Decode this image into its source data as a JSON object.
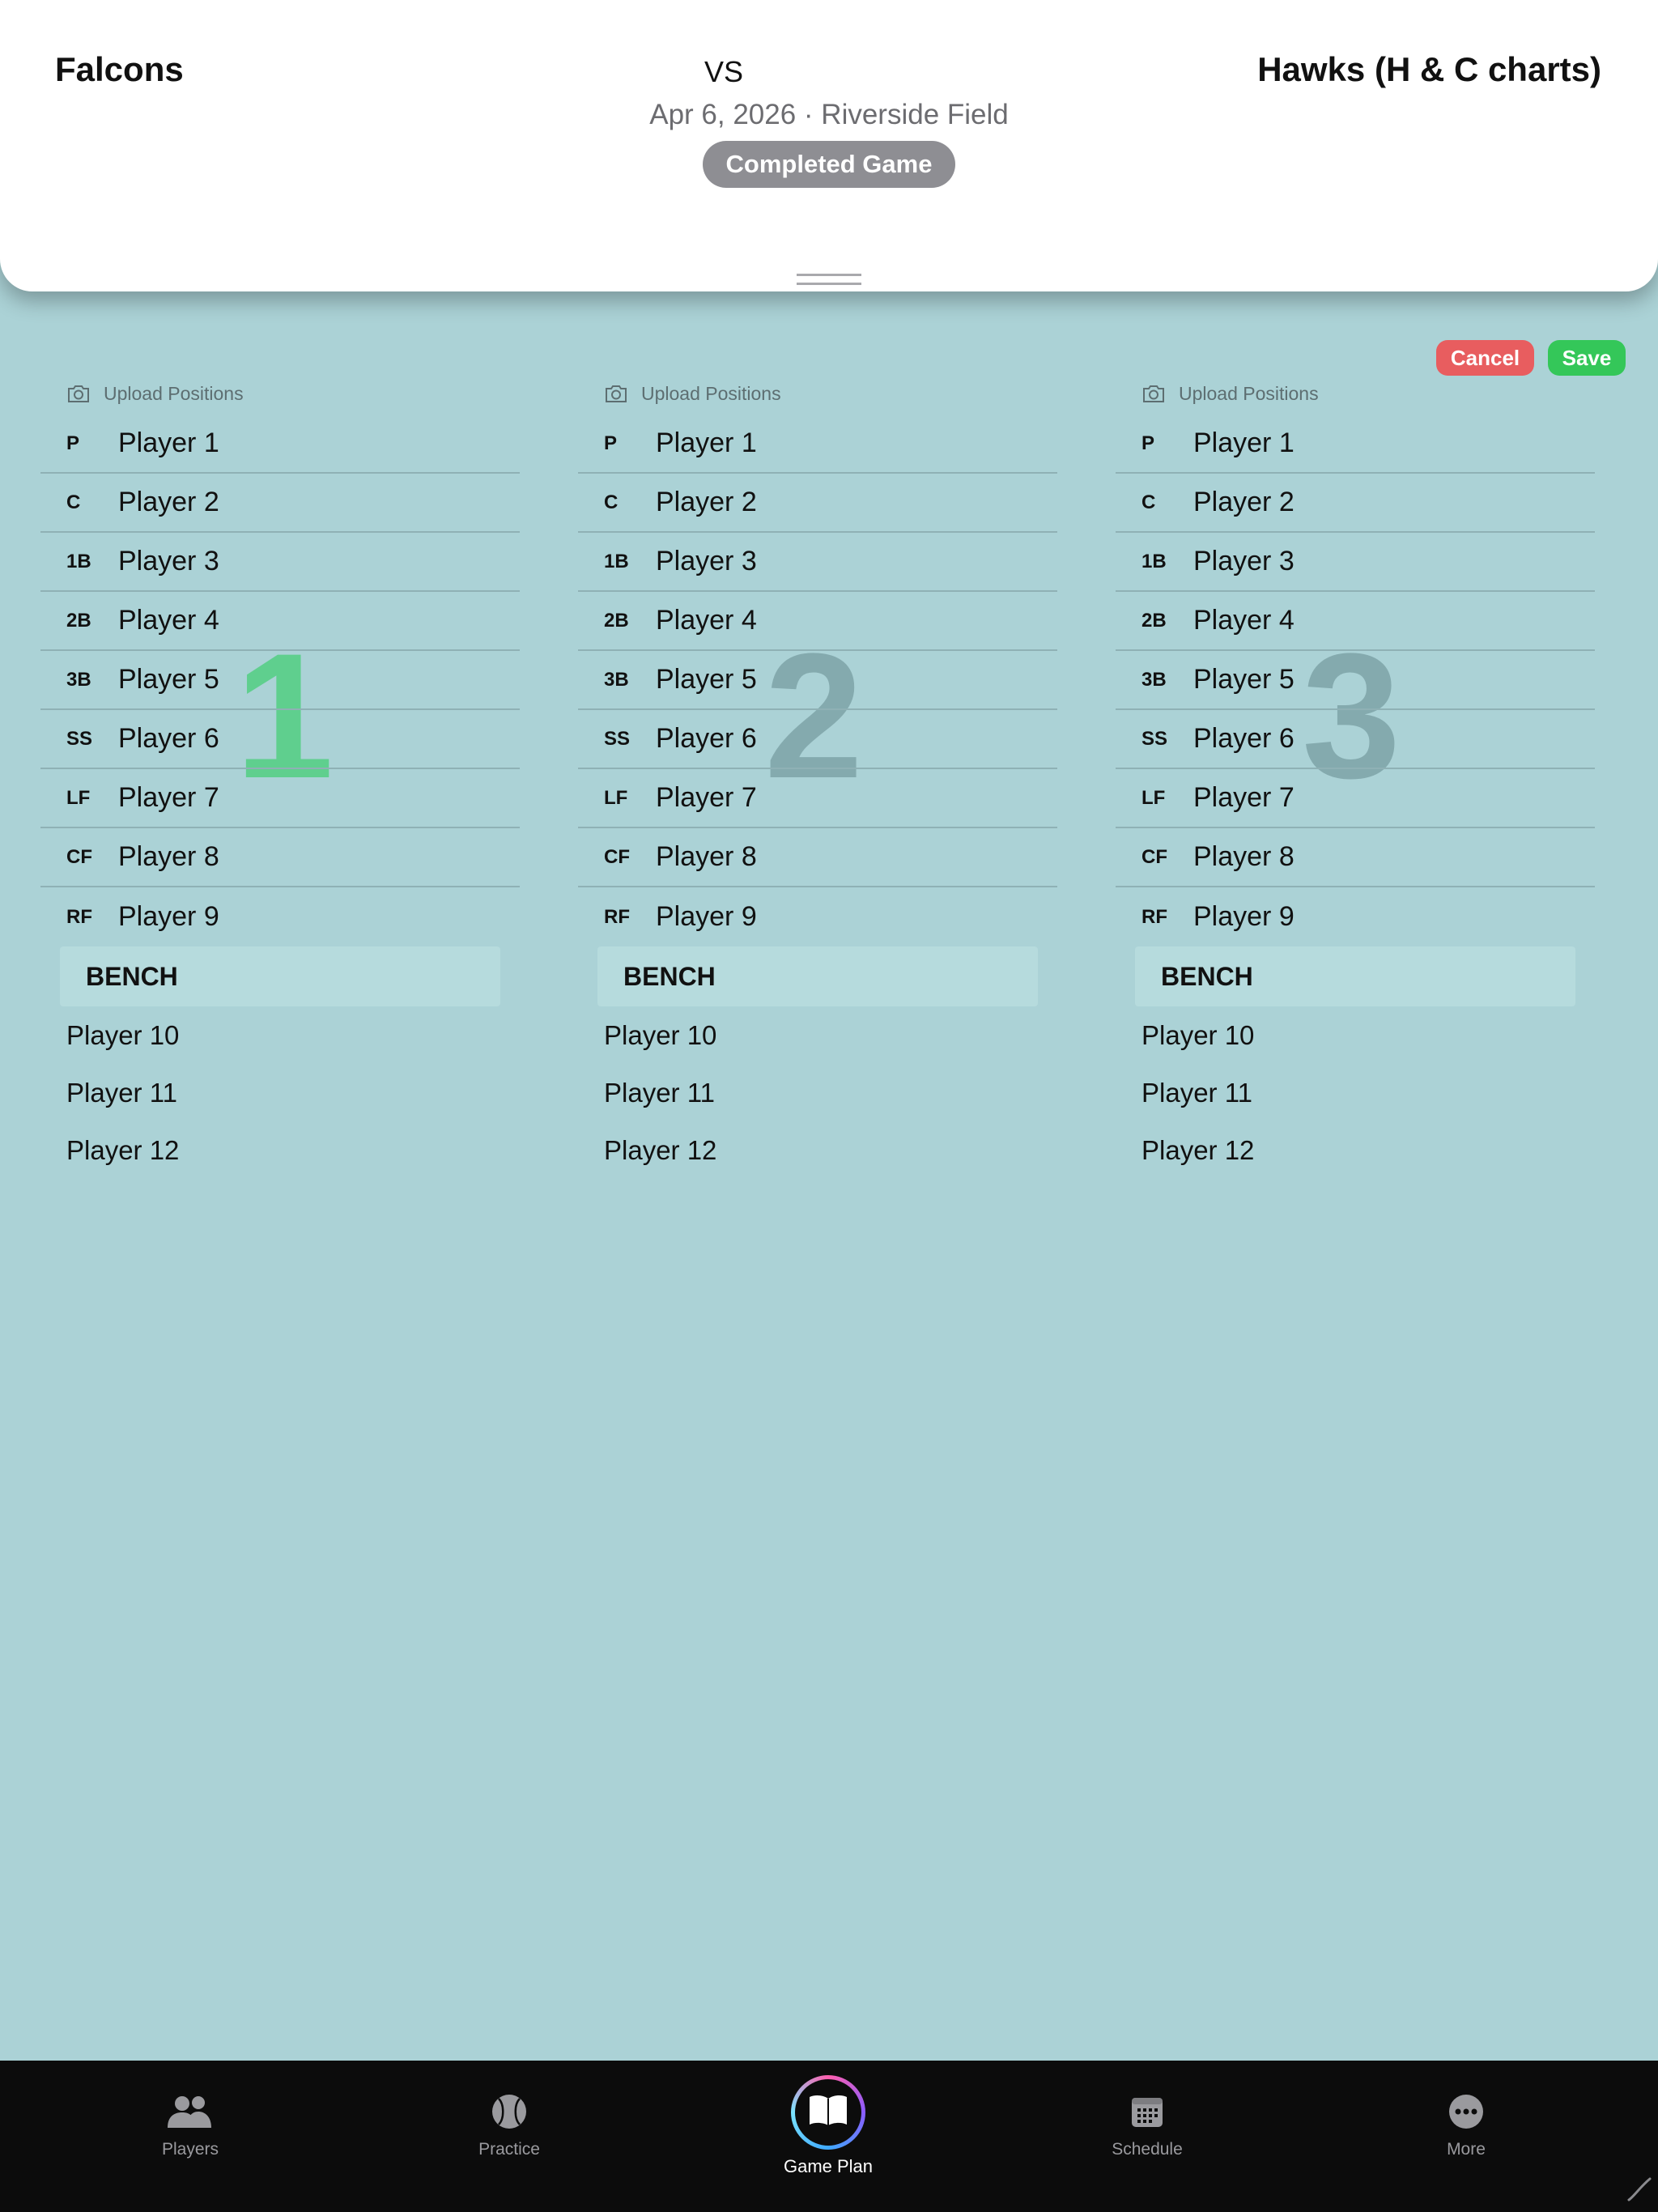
{
  "header": {
    "home_team": "Falcons",
    "vs": "VS",
    "away_team": "Hawks (H & C charts)",
    "game_info": "Apr 6, 2026 · Riverside Field",
    "status": "Completed Game"
  },
  "actions": {
    "cancel": "Cancel",
    "save": "Save"
  },
  "innings": [
    {
      "number": "1",
      "number_color": "#5fcf8e",
      "upload_label": "Upload Positions",
      "positions": [
        {
          "code": "P",
          "player": "Player 1"
        },
        {
          "code": "C",
          "player": "Player 2"
        },
        {
          "code": "1B",
          "player": "Player 3"
        },
        {
          "code": "2B",
          "player": "Player 4"
        },
        {
          "code": "3B",
          "player": "Player 5"
        },
        {
          "code": "SS",
          "player": "Player 6"
        },
        {
          "code": "LF",
          "player": "Player 7"
        },
        {
          "code": "CF",
          "player": "Player 8"
        },
        {
          "code": "RF",
          "player": "Player 9"
        }
      ],
      "bench_label": "BENCH",
      "bench": [
        "Player 10",
        "Player 11",
        "Player 12"
      ]
    },
    {
      "number": "2",
      "number_color": "#84aaae",
      "upload_label": "Upload Positions",
      "positions": [
        {
          "code": "P",
          "player": "Player 1"
        },
        {
          "code": "C",
          "player": "Player 2"
        },
        {
          "code": "1B",
          "player": "Player 3"
        },
        {
          "code": "2B",
          "player": "Player 4"
        },
        {
          "code": "3B",
          "player": "Player 5"
        },
        {
          "code": "SS",
          "player": "Player 6"
        },
        {
          "code": "LF",
          "player": "Player 7"
        },
        {
          "code": "CF",
          "player": "Player 8"
        },
        {
          "code": "RF",
          "player": "Player 9"
        }
      ],
      "bench_label": "BENCH",
      "bench": [
        "Player 10",
        "Player 11",
        "Player 12"
      ]
    },
    {
      "number": "3",
      "number_color": "#84aaae",
      "upload_label": "Upload Positions",
      "positions": [
        {
          "code": "P",
          "player": "Player 1"
        },
        {
          "code": "C",
          "player": "Player 2"
        },
        {
          "code": "1B",
          "player": "Player 3"
        },
        {
          "code": "2B",
          "player": "Player 4"
        },
        {
          "code": "3B",
          "player": "Player 5"
        },
        {
          "code": "SS",
          "player": "Player 6"
        },
        {
          "code": "LF",
          "player": "Player 7"
        },
        {
          "code": "CF",
          "player": "Player 8"
        },
        {
          "code": "RF",
          "player": "Player 9"
        }
      ],
      "bench_label": "BENCH",
      "bench": [
        "Player 10",
        "Player 11",
        "Player 12"
      ]
    }
  ],
  "tabbar": {
    "items": [
      {
        "label": "Players",
        "icon": "players-icon"
      },
      {
        "label": "Practice",
        "icon": "baseball-icon"
      },
      {
        "label": "Game Plan",
        "icon": "book-icon",
        "active": true
      },
      {
        "label": "Schedule",
        "icon": "calendar-icon"
      },
      {
        "label": "More",
        "icon": "more-icon"
      }
    ]
  }
}
